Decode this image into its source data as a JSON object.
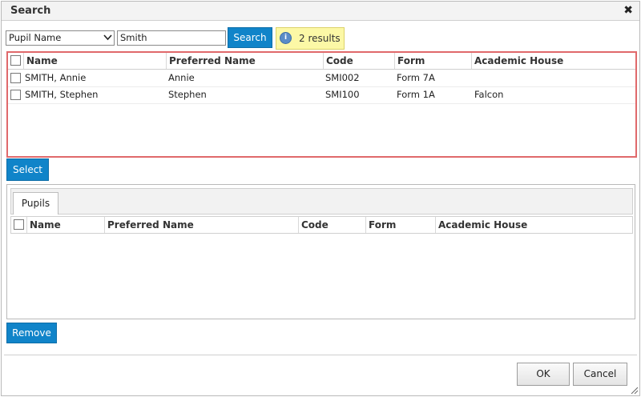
{
  "dialog": {
    "title": "Search"
  },
  "search": {
    "field_selected": "Pupil Name",
    "query": "Smith",
    "button_label": "Search",
    "results_text": "2 results"
  },
  "results_grid": {
    "columns": [
      "Name",
      "Preferred Name",
      "Code",
      "Form",
      "Academic House"
    ],
    "rows": [
      {
        "name": "SMITH, Annie",
        "preferred": "Annie",
        "code": "SMI002",
        "form": "Form 7A",
        "house": ""
      },
      {
        "name": "SMITH, Stephen",
        "preferred": "Stephen",
        "code": "SMI100",
        "form": "Form 1A",
        "house": "Falcon"
      }
    ]
  },
  "select_button": "Select",
  "pupils_panel": {
    "tab_label": "Pupils",
    "columns": [
      "Name",
      "Preferred Name",
      "Code",
      "Form",
      "Academic House"
    ]
  },
  "remove_button": "Remove",
  "footer": {
    "ok": "OK",
    "cancel": "Cancel"
  },
  "colors": {
    "accent": "#1084c9",
    "grid_focus_border": "#e0696b",
    "results_bg": "#fcf8a6"
  }
}
